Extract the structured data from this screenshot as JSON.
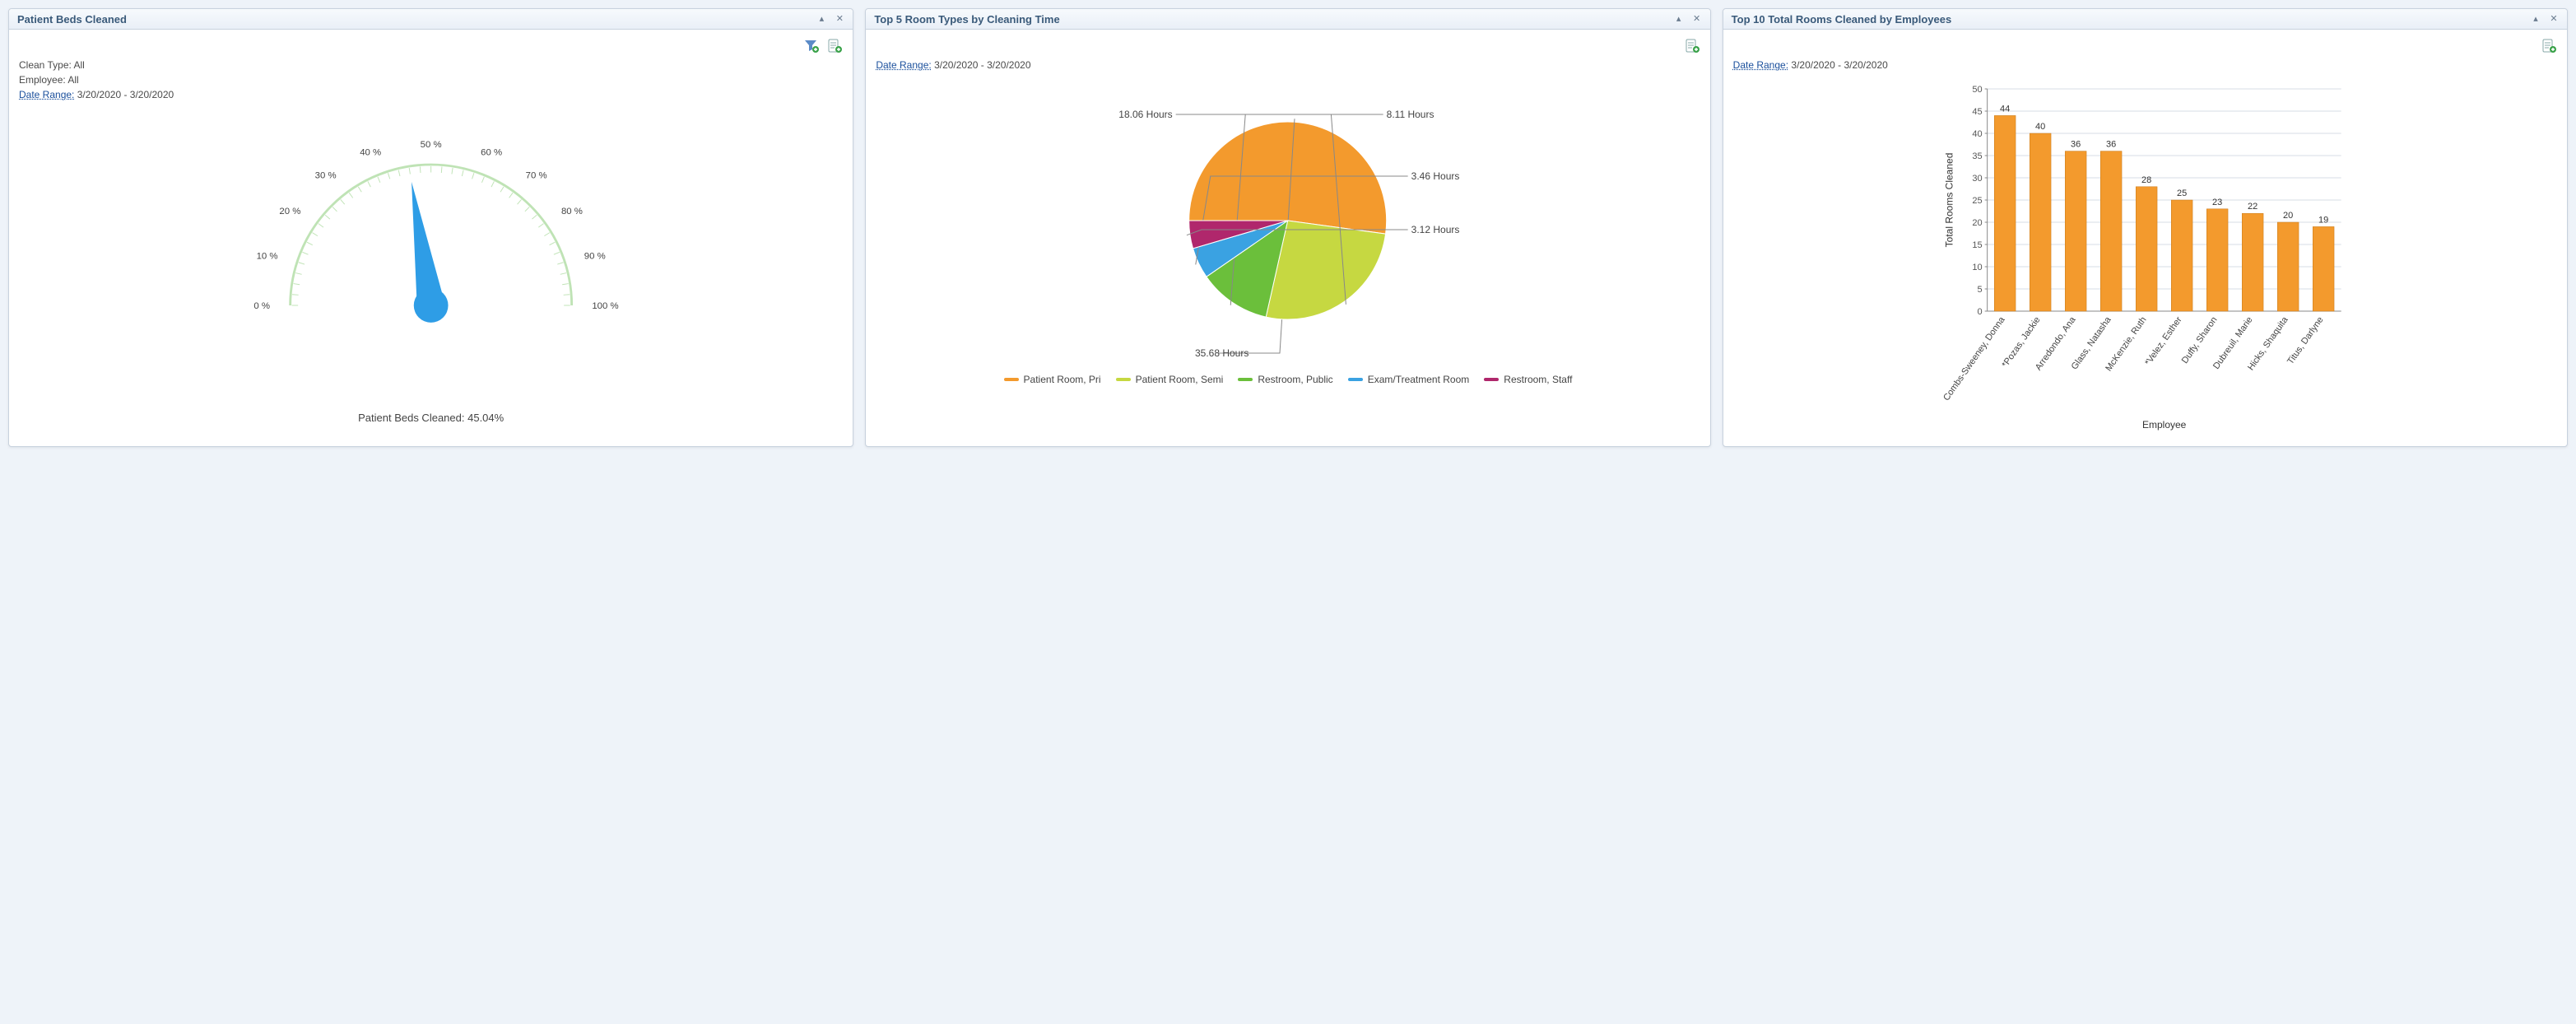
{
  "panels": {
    "gauge": {
      "title": "Patient Beds Cleaned",
      "clean_type_label": "Clean Type:",
      "clean_type_value": "All",
      "employee_label": "Employee:",
      "employee_value": "All",
      "date_range_label": "Date Range:",
      "date_range_value": "3/20/2020 - 3/20/2020",
      "caption_label": "Patient Beds Cleaned:",
      "caption_value": "45.04%"
    },
    "pie": {
      "title": "Top 5 Room Types by Cleaning Time",
      "date_range_label": "Date Range:",
      "date_range_value": "3/20/2020 - 3/20/2020"
    },
    "bar": {
      "title": "Top 10 Total Rooms Cleaned by Employees",
      "date_range_label": "Date Range:",
      "date_range_value": "3/20/2020 - 3/20/2020"
    }
  },
  "chart_data": [
    {
      "id": "gauge",
      "type": "gauge",
      "title": "Patient Beds Cleaned",
      "value_pct": 45.04,
      "range_pct": [
        0,
        100
      ],
      "tick_labels": [
        "0 %",
        "10 %",
        "20 %",
        "30 %",
        "40 %",
        "50 %",
        "60 %",
        "70 %",
        "80 %",
        "90 %",
        "100 %"
      ]
    },
    {
      "id": "pie",
      "type": "pie",
      "title": "Top 5 Room Types by Cleaning Time",
      "value_unit": "Hours",
      "series": [
        {
          "name": "Patient Room, Pri",
          "value": 35.68,
          "color": "#f39a2d"
        },
        {
          "name": "Patient Room, Semi",
          "value": 18.06,
          "color": "#c6d841"
        },
        {
          "name": "Restroom, Public",
          "value": 8.11,
          "color": "#6bbf3b"
        },
        {
          "name": "Exam/Treatment Room",
          "value": 3.46,
          "color": "#3aa2e2"
        },
        {
          "name": "Restroom, Staff",
          "value": 3.12,
          "color": "#b0276c"
        }
      ]
    },
    {
      "id": "bar",
      "type": "bar",
      "title": "Top 10 Total Rooms Cleaned by Employees",
      "xlabel": "Employee",
      "ylabel": "Total Rooms Cleaned",
      "ylim": [
        0,
        50
      ],
      "ytick_step": 5,
      "bar_color": "#f39a2d",
      "categories": [
        "Combs-Sweeney, Donna",
        "*Pozas, Jackie",
        "Arredondo, Ana",
        "Glass, Natasha",
        "McKenzie, Ruth",
        "*Velez, Esther",
        "Duffy, Sharon",
        "Dubreuil, Marie",
        "Hicks, Shaquita",
        "Titus, Darlyne"
      ],
      "values": [
        44,
        40,
        36,
        36,
        28,
        25,
        23,
        22,
        20,
        19
      ]
    }
  ]
}
